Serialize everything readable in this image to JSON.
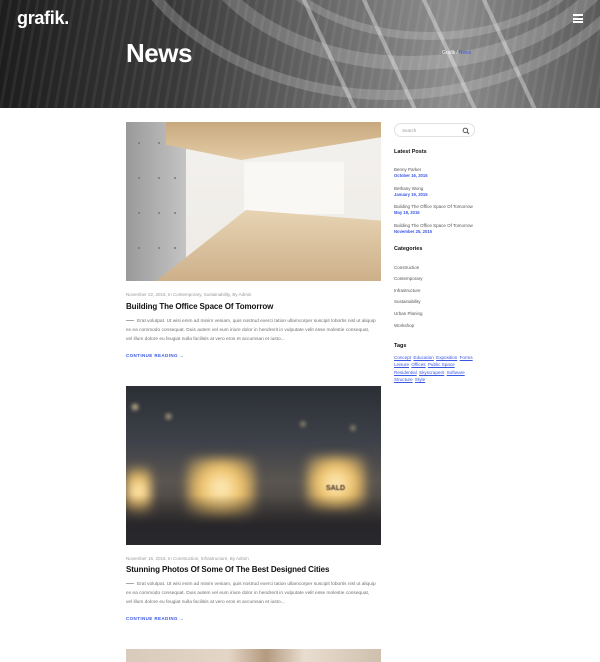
{
  "header": {
    "logo": "grafik.",
    "page_title": "News",
    "breadcrumb": {
      "home": "Grafik",
      "separator": "/",
      "current": "News"
    }
  },
  "posts": [
    {
      "meta": "November 22, 2015, In Contemporary, Sustainability, By Admin",
      "title": "Building The Office Space Of Tomorrow",
      "excerpt": "Erat volutpat. Ut wisi enim ad minim veniam, quis nostrud exerci tation ullamcorper suscipit lobortis nisl ut aliquip ex ea commodo consequat. Duis autem vel eum iriure dolor in hendrerit in vulputate velit esse molestie consequat, vel illum dolore eu feugiat nulla facilisis at vero eros et accumsan et iusto...",
      "read_more": "CONTINUE READING  →"
    },
    {
      "meta": "November 16, 2015, In Construction, Infrastructure, By Admin",
      "title": "Stunning Photos Of Some Of The Best Designed Cities",
      "excerpt": "Erat volutpat. Ut wisi enim ad minim veniam, quis nostrud exerci tation ullamcorper suscipit lobortis nisl ut aliquip ex ea commodo consequat. Duis autem vel eum iriure dolor in hendrerit in vulputate velit esse molestie consequat, vel illum dolore eu feugiat nulla facilisis at vero eros et accumsan et iusto...",
      "read_more": "CONTINUE READING  →",
      "image_sign": "SALD"
    }
  ],
  "sidebar": {
    "search_placeholder": "Search",
    "latest_posts_title": "Latest Posts",
    "latest_posts": [
      {
        "title": "Benny Parker",
        "date": "October 16, 2015"
      },
      {
        "title": "Bethany Wong",
        "date": "January 19, 2015"
      },
      {
        "title": "Building The Office Space Of Tomorrow",
        "date": "May 18, 2015"
      },
      {
        "title": "Building The Office Space Of Tomorrow",
        "date": "November 25, 2015"
      }
    ],
    "categories_title": "Categories",
    "categories": [
      "Construction",
      "Contemporary",
      "Infrastructure",
      "Sustainability",
      "Urban Planing",
      "Workshop"
    ],
    "tags_title": "Tags",
    "tags": [
      "Concept",
      "Education",
      "Exposition",
      "Forms",
      "Leisure",
      "Offices",
      "Public Space",
      "Residential",
      "Skyscrapers",
      "Software",
      "Structure",
      "Style"
    ]
  },
  "colors": {
    "accent": "#3a56e4",
    "header_dark": "#1d1d1d",
    "text_dark": "#111111",
    "text_muted": "#707070"
  },
  "icons": [
    "hamburger-menu-icon",
    "search-icon",
    "arrow-right-icon"
  ]
}
